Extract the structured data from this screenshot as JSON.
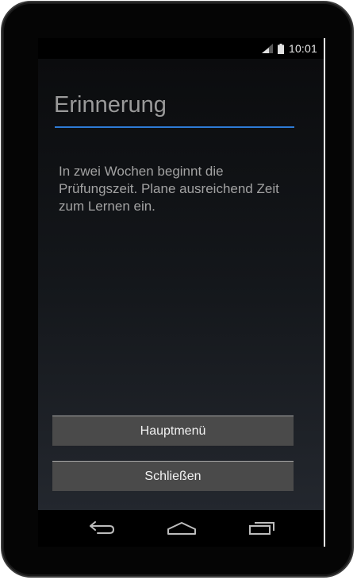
{
  "status_bar": {
    "time": "10:01",
    "icons": [
      "signal-icon",
      "battery-icon"
    ]
  },
  "dialog": {
    "title": "Erinnerung",
    "message": "In zwei Wochen beginnt die Prüfungszeit. Plane ausreichend Zeit zum Lernen ein.",
    "buttons": {
      "main_menu": "Hauptmenü",
      "close": "Schließen"
    }
  },
  "nav_bar": {
    "icons": [
      "back-icon",
      "home-icon",
      "recent-apps-icon"
    ]
  },
  "colors": {
    "accent": "#2e7bd6",
    "button_bg": "#4a4a4a",
    "title_text": "#9a9a9a",
    "body_text": "#a2a2a2"
  }
}
